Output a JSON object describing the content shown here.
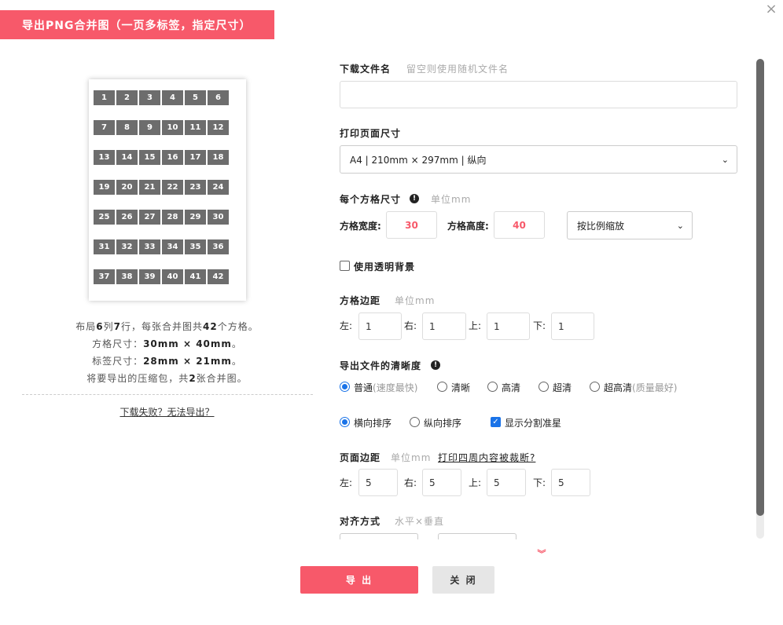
{
  "dialog": {
    "title": "导出PNG合并图（一页多标签，指定尺寸）",
    "close_glyph": "×"
  },
  "preview": {
    "cells": [
      "1",
      "2",
      "3",
      "4",
      "5",
      "6",
      "7",
      "8",
      "9",
      "10",
      "11",
      "12",
      "13",
      "14",
      "15",
      "16",
      "17",
      "18",
      "19",
      "20",
      "21",
      "22",
      "23",
      "24",
      "25",
      "26",
      "27",
      "28",
      "29",
      "30",
      "31",
      "32",
      "33",
      "34",
      "35",
      "36",
      "37",
      "38",
      "39",
      "40",
      "41",
      "42"
    ],
    "columns": 6,
    "rows": 7
  },
  "summary": {
    "line1_a": "布局",
    "cols": "6",
    "line1_b": "列",
    "rows": "7",
    "line1_c": "行，每张合并图共",
    "count": "42",
    "line1_d": "个方格。",
    "line2_label": "方格尺寸：",
    "line2_value": "30mm × 40mm",
    "line2_end": "。",
    "line3_label": "标签尺寸：",
    "line3_value": "28mm × 21mm",
    "line3_end": "。",
    "line4_a": "将要导出的压缩包，共",
    "pages": "2",
    "line4_b": "张合并图。",
    "fail_link": "下载失败？无法导出？"
  },
  "form": {
    "filename_label": "下载文件名",
    "filename_hint": "留空则使用随机文件名",
    "filename_value": "",
    "pagesize_label": "打印页面尺寸",
    "pagesize_value": "A4 | 210mm × 297mm | 纵向",
    "cellsize_label": "每个方格尺寸",
    "cellsize_info": "!",
    "cellsize_hint": "单位mm",
    "cell_width_label": "方格宽度:",
    "cell_width_value": "30",
    "cell_height_label": "方格高度:",
    "cell_height_value": "40",
    "scale_value": "按比例缩放",
    "transparent_label": "使用透明背景",
    "cellmargin_label": "方格边距",
    "cellmargin_hint": "单位mm",
    "left_label": "左:",
    "right_label": "右:",
    "top_label": "上:",
    "bottom_label": "下:",
    "cellmargin_left": "1",
    "cellmargin_right": "1",
    "cellmargin_top": "1",
    "cellmargin_bottom": "1",
    "clarity_label": "导出文件的清晰度",
    "clarity_info": "!",
    "clarity_options": [
      {
        "label": "普通",
        "sub": "(速度最快)"
      },
      {
        "label": "清晰",
        "sub": ""
      },
      {
        "label": "高清",
        "sub": ""
      },
      {
        "label": "超清",
        "sub": ""
      },
      {
        "label": "超高清",
        "sub": "(质量最好)"
      }
    ],
    "order_horizontal": "横向排序",
    "order_vertical": "纵向排序",
    "show_crosshair": "显示分割准星",
    "check_glyph": "✓",
    "pagemargin_label": "页面边距",
    "pagemargin_hint": "单位mm",
    "pagemargin_link": "打印四周内容被裁断?",
    "pagemargin_left": "5",
    "pagemargin_right": "5",
    "pagemargin_top": "5",
    "pagemargin_bottom": "5",
    "align_label": "对齐方式",
    "align_hint": "水平×垂直",
    "chevron_glyph": "⌄",
    "more_glyph": "︾"
  },
  "footer": {
    "export_label": "导 出",
    "close_label": "关 闭"
  },
  "colors": {
    "accent": "#f7596a",
    "primary_blue": "#1a73e8",
    "cell_gray": "#6d6d6d"
  }
}
